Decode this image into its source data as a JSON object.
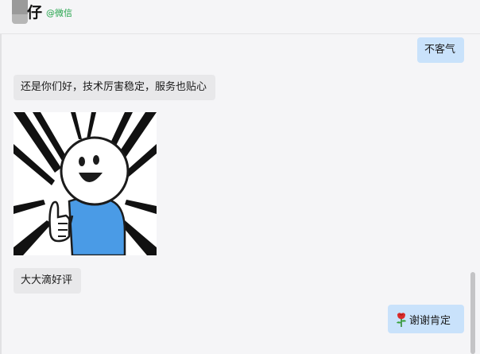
{
  "header": {
    "contact_name": "仔",
    "contact_source": "@微信"
  },
  "messages": [
    {
      "direction": "out",
      "text": "不客气"
    },
    {
      "direction": "in",
      "text": "还是你们好，技术厉害稳定，服务也贴心"
    },
    {
      "direction": "in",
      "type": "sticker",
      "sticker": "thumbs-up-cartoon"
    },
    {
      "direction": "in",
      "text": "大大滴好评"
    },
    {
      "direction": "out",
      "emoji": "rose",
      "text": "谢谢肯定"
    }
  ]
}
